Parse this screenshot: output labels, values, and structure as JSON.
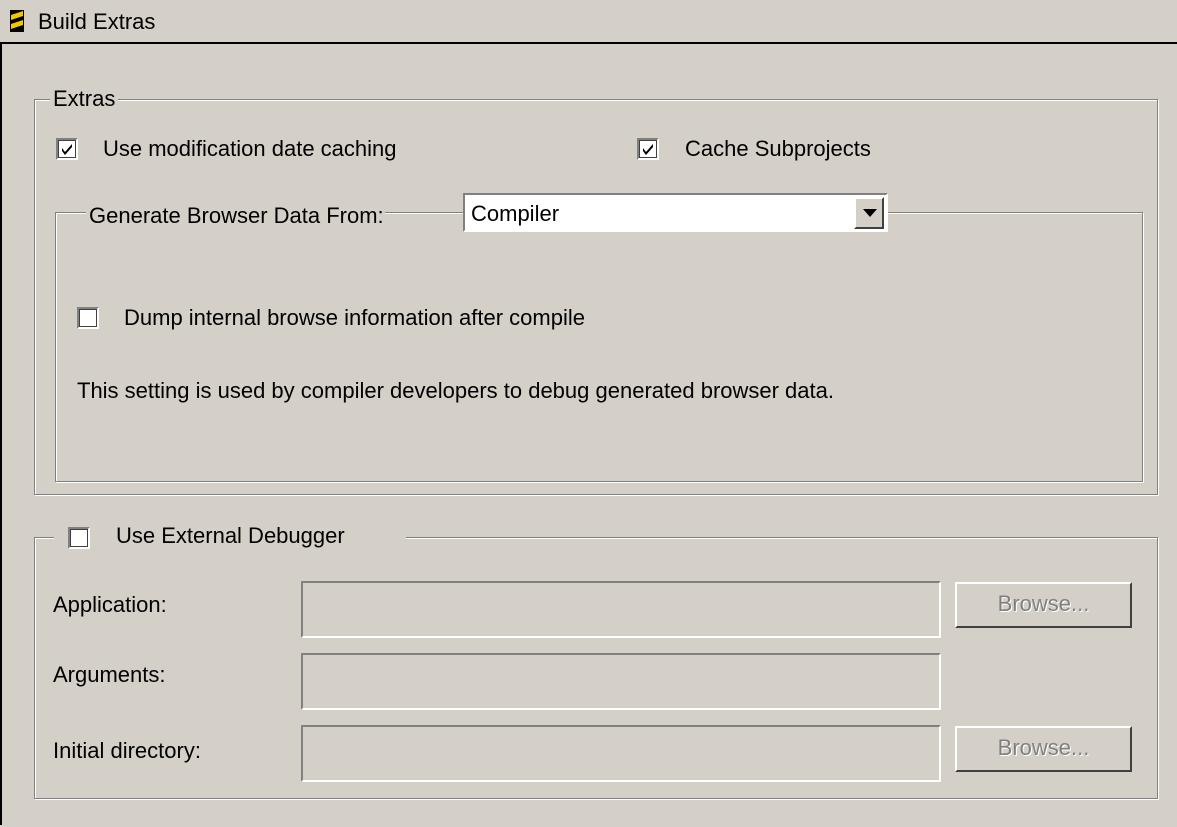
{
  "window": {
    "title": "Build Extras",
    "icon": "build-icon"
  },
  "extras": {
    "legend": "Extras",
    "use_mod_date_caching": {
      "label": "Use modification date caching",
      "checked": true
    },
    "cache_subprojects": {
      "label": "Cache Subprojects",
      "checked": true
    },
    "browser": {
      "legend": "Generate Browser Data From:",
      "source": {
        "value": "Compiler",
        "icon": "chevron-down-icon"
      },
      "dump_info": {
        "label": "Dump internal browse information after compile",
        "checked": false
      },
      "note": "This setting is used by compiler developers to debug generated browser data."
    }
  },
  "debugger": {
    "use_external": {
      "label": "Use External Debugger",
      "checked": false
    },
    "application": {
      "label": "Application:",
      "value": "",
      "browse_label": "Browse..."
    },
    "arguments": {
      "label": "Arguments:",
      "value": ""
    },
    "initial_directory": {
      "label": "Initial directory:",
      "value": "",
      "browse_label": "Browse..."
    }
  },
  "colors": {
    "dialog_bg": "#d4d0c8",
    "shadow": "#808080",
    "highlight": "#ffffff",
    "disabled_text": "#808080"
  }
}
